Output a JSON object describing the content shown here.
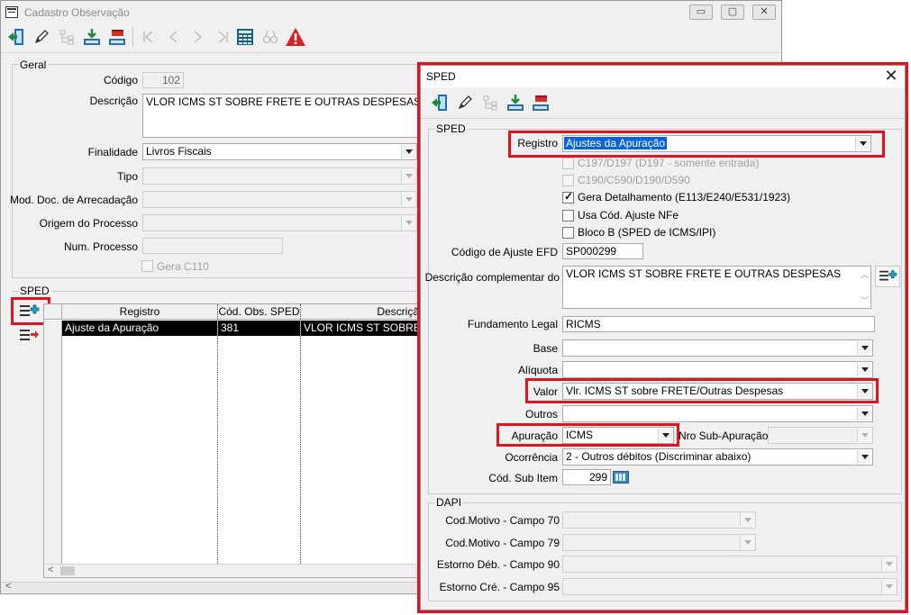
{
  "main_window": {
    "title": "Cadastro Observação",
    "caption_buttons": [
      "▭",
      "▢",
      "✕"
    ],
    "toolbar": {
      "buttons": [
        {
          "icon": "exit-door-icon",
          "enabled": true
        },
        {
          "icon": "pencil-edit-icon",
          "enabled": true
        },
        {
          "icon": "tree-structure-icon",
          "enabled": false
        },
        {
          "icon": "save-tray-icon",
          "enabled": true
        },
        {
          "icon": "cancel-tray-icon",
          "enabled": true
        },
        {
          "icon": "first-record-icon",
          "enabled": false
        },
        {
          "icon": "previous-record-icon",
          "enabled": false
        },
        {
          "icon": "next-record-icon",
          "enabled": false
        },
        {
          "icon": "last-record-icon",
          "enabled": false
        },
        {
          "icon": "calculator-grid-icon",
          "enabled": true
        },
        {
          "icon": "binoculars-search-icon",
          "enabled": false
        },
        {
          "icon": "warning-triangle-icon",
          "enabled": true
        }
      ]
    },
    "geral": {
      "group_label": "Geral",
      "codigo_label": "Código",
      "codigo_value": "102",
      "descricao_label": "Descrição",
      "descricao_value": "VLOR ICMS ST SOBRE FRETE E OUTRAS DESPESAS",
      "finalidade_label": "Finalidade",
      "finalidade_value": "Livros Fiscais",
      "tipo_label": "Tipo",
      "tipo_value": "",
      "mod_doc_label": "Mod. Doc. de Arrecadação",
      "mod_doc_value": "",
      "origem_label": "Origem do Processo",
      "origem_value": "",
      "num_processo_label": "Num. Processo",
      "num_processo_value": "",
      "gera_c110_label": "Gera C110",
      "gera_c110_checked": false
    },
    "sped": {
      "group_label": "SPED",
      "columns": [
        "Registro",
        "Cód. Obs. SPED",
        "Descrição C"
      ],
      "rows": [
        {
          "registro": "Ajuste da Apuração",
          "cod": "381",
          "descricao": "VLOR ICMS ST SOBRE FR"
        }
      ],
      "scroll_left": "<"
    }
  },
  "sped_dialog": {
    "title": "SPED",
    "close": "✕",
    "group_label": "SPED",
    "registro_label": "Registro",
    "registro_value": "Ajustes da Apuração",
    "checkboxes": [
      {
        "label": "C197/D197 (D197 - somente entrada)",
        "checked": false,
        "enabled": false
      },
      {
        "label": "C190/C590/D190/D590",
        "checked": false,
        "enabled": false
      },
      {
        "label": "Gera Detalhamento (E113/E240/E531/1923)",
        "checked": true,
        "enabled": true
      },
      {
        "label": "Usa Cód. Ajuste NFe",
        "checked": false,
        "enabled": true
      },
      {
        "label": "Bloco B (SPED de ICMS/IPI)",
        "checked": false,
        "enabled": true
      }
    ],
    "codigo_ajuste_label": "Código de Ajuste EFD",
    "codigo_ajuste_value": "SP000299",
    "descricao_compl_label": "Descrição complementar do",
    "descricao_compl_value": "VLOR ICMS ST SOBRE FRETE E OUTRAS DESPESAS",
    "fundamento_label": "Fundamento Legal",
    "fundamento_value": "RICMS",
    "base_label": "Base",
    "base_value": "",
    "aliquota_label": "Alíquota",
    "aliquota_value": "",
    "valor_label": "Valor",
    "valor_value": "Vlr. ICMS ST sobre FRETE/Outras Despesas",
    "outros_label": "Outros",
    "outros_value": "",
    "apuracao_label": "Apuração",
    "apuracao_value": "ICMS",
    "nro_sub_label": "Nro Sub-Apuração",
    "nro_sub_value": "",
    "ocorrencia_label": "Ocorrência",
    "ocorrencia_value": "2 - Outros débitos (Discriminar abaixo)",
    "cod_sub_item_label": "Cód. Sub Item",
    "cod_sub_item_value": "299",
    "dapi": {
      "group_label": "DAPI",
      "motivo70_label": "Cod.Motivo - Campo 70",
      "motivo79_label": "Cod.Motivo - Campo 79",
      "estorno90_label": "Estorno Déb. - Campo 90",
      "estorno95_label": "Estorno Cré. - Campo 95"
    }
  },
  "colors": {
    "highlight": "#e0141e",
    "selection": "#0a64d8",
    "window_bg": "#f0f0f0"
  }
}
